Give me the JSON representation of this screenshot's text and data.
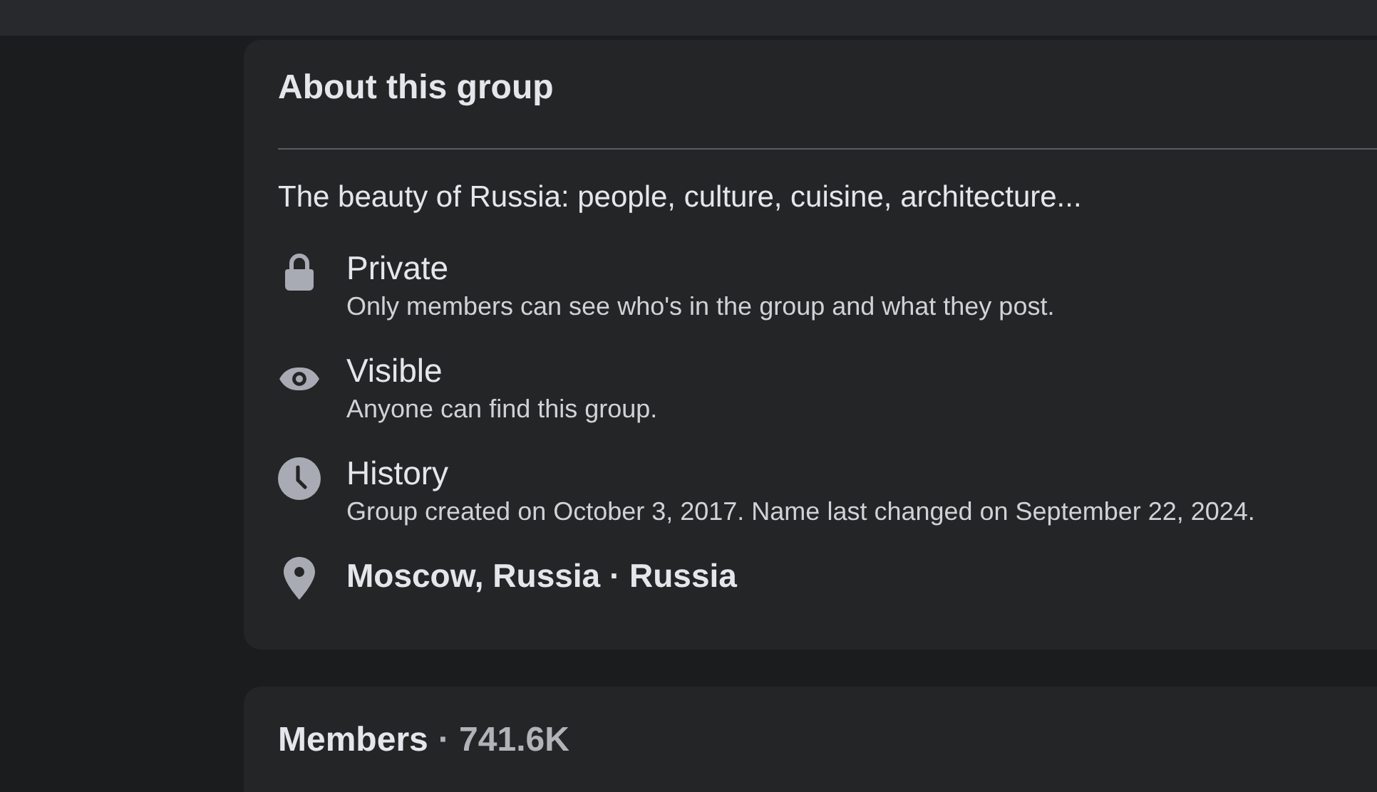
{
  "about": {
    "title": "About this group",
    "description": "The beauty of Russia: people, culture, cuisine, architecture...",
    "items": [
      {
        "kind": "lock",
        "title": "Private",
        "detail": "Only members can see who's in the group and what they post."
      },
      {
        "kind": "eye",
        "title": "Visible",
        "detail": "Anyone can find this group."
      },
      {
        "kind": "clock",
        "title": "History",
        "detail": "Group created on October 3, 2017. Name last changed on September 22, 2024."
      },
      {
        "kind": "pin",
        "title": "Moscow, Russia · Russia"
      }
    ]
  },
  "members": {
    "title": "Members",
    "count": "· 741.6K"
  }
}
